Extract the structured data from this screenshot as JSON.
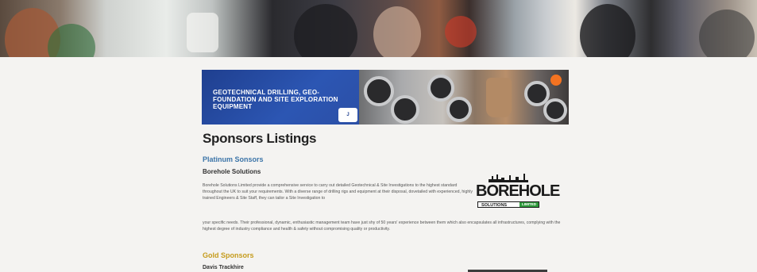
{
  "banner": {
    "logo_text": "",
    "heading": "GEOTECHNICAL DRILLING, GEO-FOUNDATION AND SITE EXPLORATION EQUIPMENT",
    "badge": "J"
  },
  "page": {
    "title": "Sponsors Listings"
  },
  "sponsors": {
    "platinum": {
      "label": "Platinum Sonsors",
      "name": "Borehole Solutions",
      "description_1": "Borehole Solutions Limited provide a comprehensive service to carry out detailed Geotechnical & Site Investigations to the highest standard throughout the UK to suit your requirements. With a diverse range of drilling rigs and equipment at their disposal, dovetailed with experienced, highly trained Engineers & Site Staff, they can tailor a Site Investigation to",
      "description_2": "your specific needs. Their professional, dynamic, enthusiastic management team have just shy of 50 years' experience between them which also encapsulates all infrastructures, complying with the highest degree of industry compliance and health & safety without compromising quality or productivity.",
      "logo": {
        "word": "BOREHOLE",
        "strap": "SOLUTIONS",
        "ltd": "LIMITED"
      }
    },
    "gold": {
      "label": "Gold Sponsors",
      "name": "Davis Trackhire"
    }
  },
  "colors": {
    "platinum": "#3b74a8",
    "gold": "#c59b1c",
    "banner_blue": "#2c56b3",
    "accent_orange": "#f37321"
  }
}
